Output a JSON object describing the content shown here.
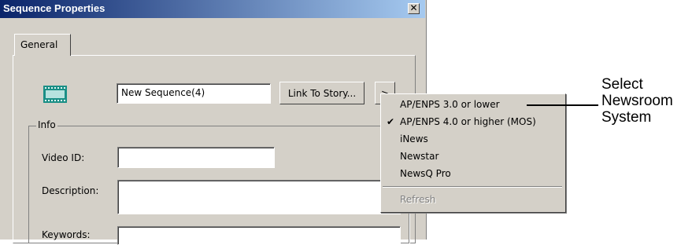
{
  "window": {
    "title": "Sequence Properties",
    "close_glyph": "✕"
  },
  "tabs": [
    {
      "label": "General"
    }
  ],
  "general": {
    "icon": "sequence-icon",
    "name_value": "New Sequence(4)",
    "link_button_label": "Link To Story...",
    "dropdown_glyph": ">"
  },
  "info": {
    "group_label": "Info",
    "video_id_label": "Video ID:",
    "description_label": "Description:",
    "keywords_label": "Keywords:",
    "video_id_value": "",
    "description_value": "",
    "keywords_value": ""
  },
  "menu": {
    "items": [
      {
        "label": "AP/ENPS 3.0 or lower",
        "checked": false
      },
      {
        "label": "AP/ENPS 4.0 or higher (MOS)",
        "checked": true
      },
      {
        "label": "iNews",
        "checked": false
      },
      {
        "label": "Newstar",
        "checked": false
      },
      {
        "label": "NewsQ Pro",
        "checked": false
      }
    ],
    "refresh_label": "Refresh",
    "check_glyph": "✔"
  },
  "callout": {
    "line1": "Select",
    "line2": "Newsroom",
    "line3": "System"
  },
  "colors": {
    "titlebar_start": "#0a246a",
    "titlebar_end": "#a6caf0",
    "dialog_face": "#d4d0c8",
    "icon_teal": "#1a8f86"
  }
}
